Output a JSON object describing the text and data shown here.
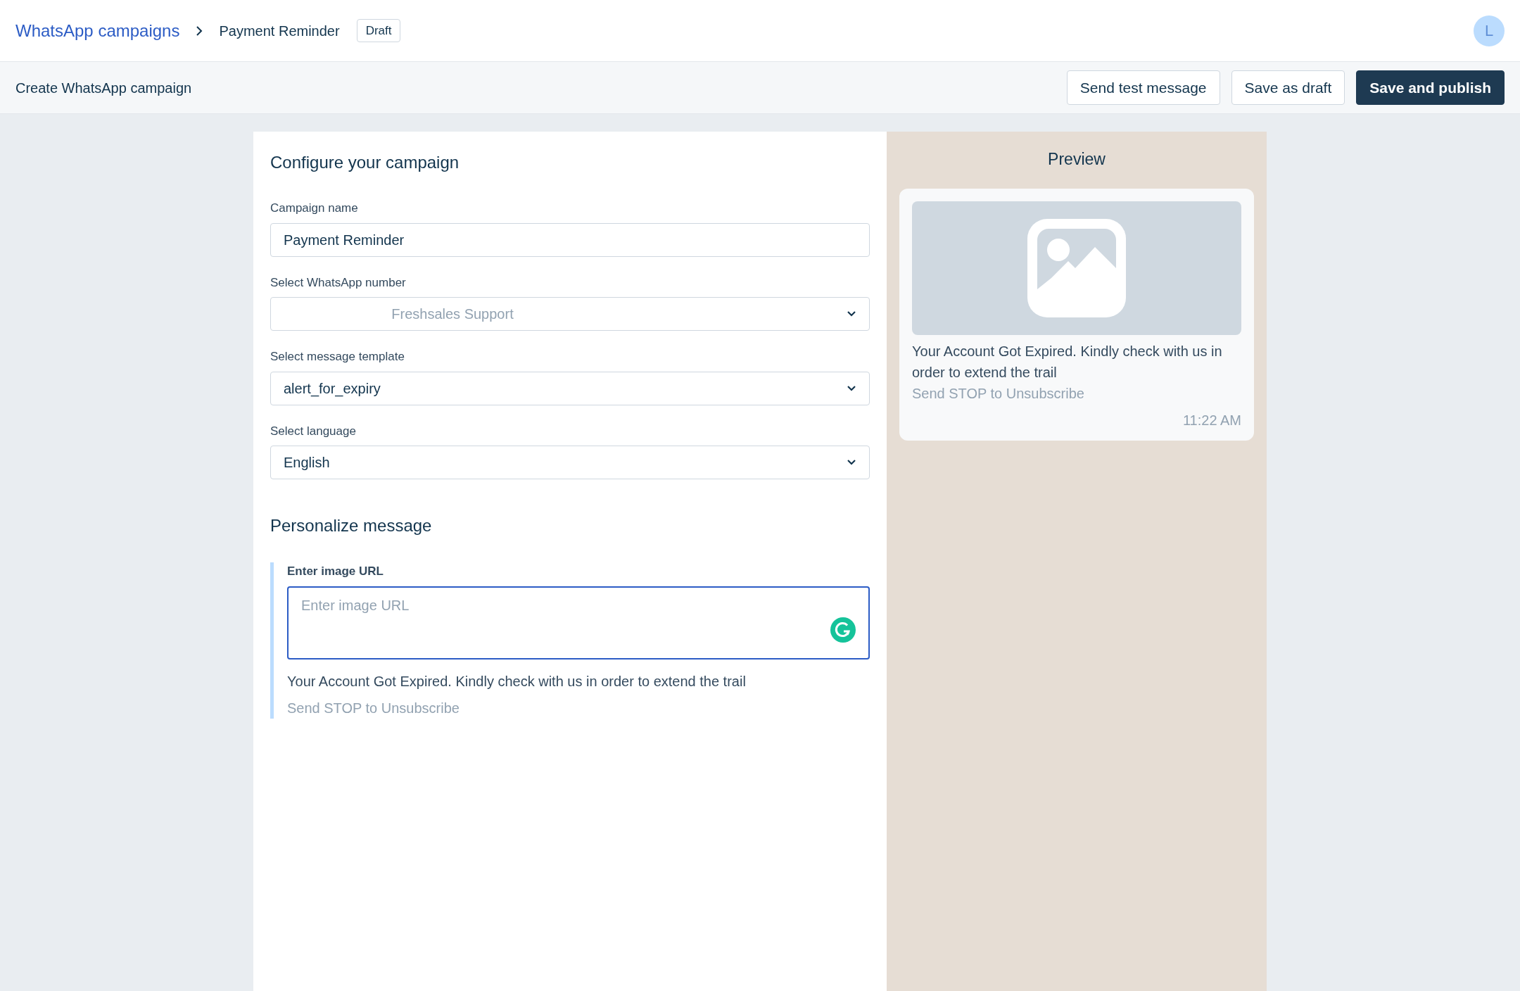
{
  "header": {
    "breadcrumb": [
      {
        "label": "WhatsApp campaigns",
        "kind": "link"
      },
      {
        "label": "Payment Reminder",
        "kind": "current"
      }
    ],
    "status_badge": "Draft",
    "avatar": "L"
  },
  "toolbar": {
    "title": "Create WhatsApp campaign",
    "buttons": [
      {
        "label": "Send test message",
        "kind": "secondary"
      },
      {
        "label": "Save as draft",
        "kind": "secondary"
      },
      {
        "label": "Save and publish",
        "kind": "primary"
      }
    ]
  },
  "configure": {
    "title": "Configure your campaign",
    "fields": [
      {
        "label": "Campaign name",
        "kind": "text",
        "value": "Payment Reminder"
      },
      {
        "label": "Select WhatsApp number",
        "kind": "select",
        "placeholder": "Freshsales Support"
      },
      {
        "label": "Select message template",
        "kind": "select",
        "value": "alert_for_expiry"
      },
      {
        "label": "Select language",
        "kind": "select",
        "value": "English"
      }
    ]
  },
  "personalize": {
    "title": "Personalize message",
    "image_url": {
      "label": "Enter image URL",
      "placeholder": "Enter image URL",
      "focused": true
    },
    "message": "Your Account Got Expired. Kindly check with us in order to extend the trail",
    "footer": "Send STOP to Unsubscribe"
  },
  "preview": {
    "title": "Preview",
    "message": "Your Account Got Expired. Kindly check with us in order to extend the trail",
    "footer": "Send STOP to Unsubscribe",
    "time": "11:22 AM"
  }
}
